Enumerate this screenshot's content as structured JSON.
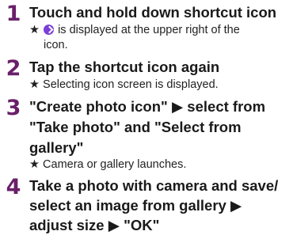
{
  "steps": [
    {
      "number": "1",
      "title_lines": [
        "Touch and hold down shortcut icon"
      ],
      "note_prefix": "★",
      "note_text_a": "is displayed at the upper right of the",
      "note_text_b": "icon.",
      "badge_icon": "check-badge-icon",
      "badge_color": "#7a3fd6"
    },
    {
      "number": "2",
      "title_lines": [
        "Tap the shortcut icon again"
      ],
      "note": "★ Selecting icon screen is displayed."
    },
    {
      "number": "3",
      "title_lines": [
        "\"Create photo icon\" ▶ select from",
        "\"Take photo\" and \"Select from",
        "gallery\""
      ],
      "note": "★ Camera or gallery launches."
    },
    {
      "number": "4",
      "title_lines": [
        "Take a photo with camera and save/",
        "select an image from gallery ▶",
        "adjust size ▶ \"OK\""
      ]
    }
  ],
  "colors": {
    "step_number": "#6a1f69",
    "text": "#1a1a1a"
  }
}
